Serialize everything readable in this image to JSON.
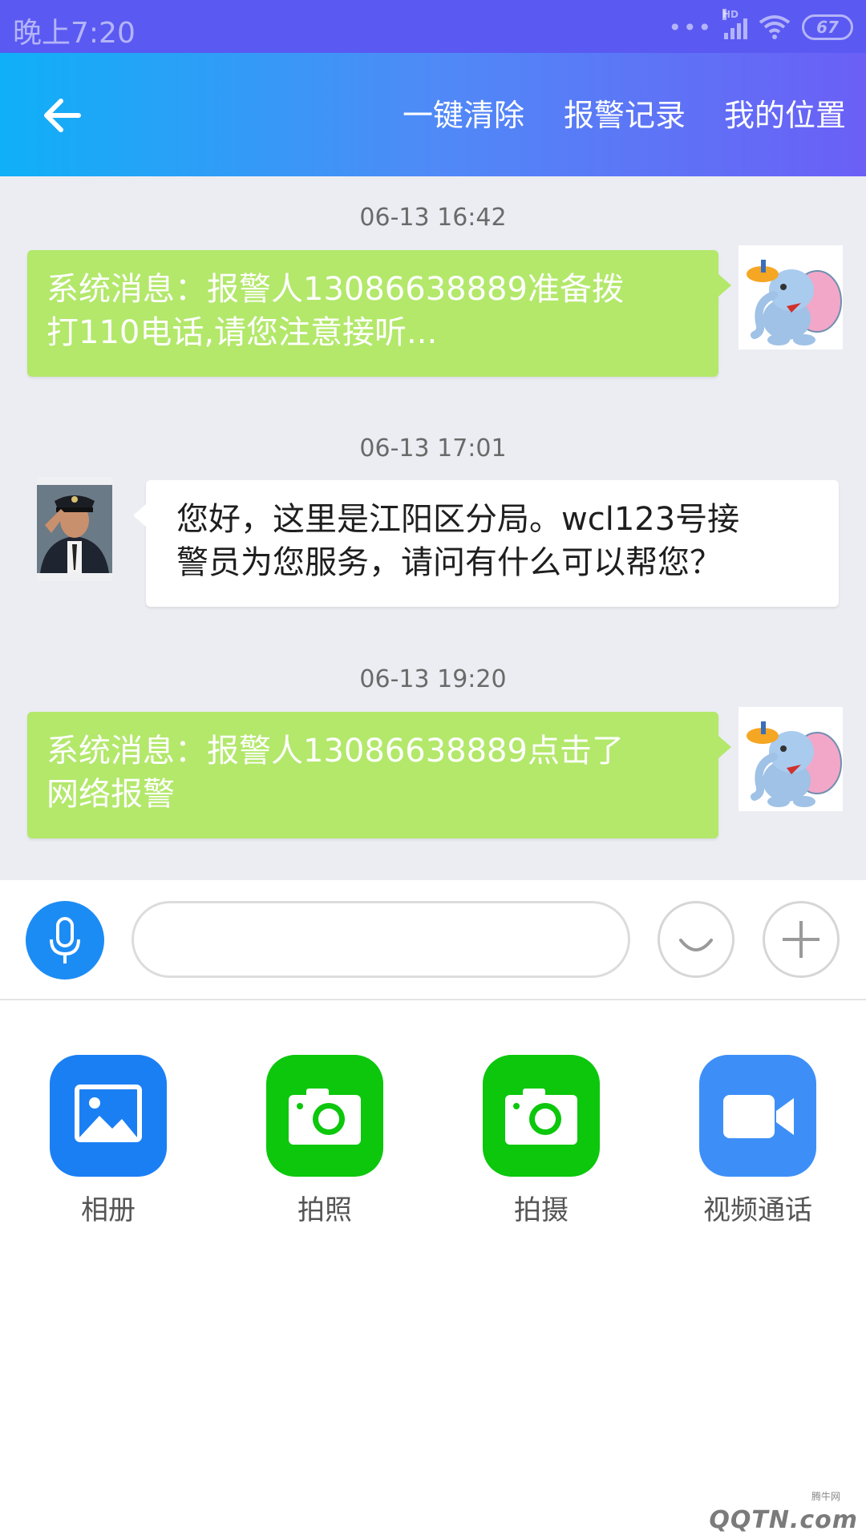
{
  "status_bar": {
    "time": "晚上7:20",
    "network_label": "HD",
    "battery_level": "67"
  },
  "app_bar": {
    "back_icon": "arrow-left-icon",
    "actions": [
      "一键清除",
      "报警记录",
      "我的位置"
    ]
  },
  "messages": [
    {
      "time": "06-13 16:42",
      "sender": "system",
      "avatar": "cartoon-elephant-avatar",
      "lines": [
        "系统消息：报警人13086638889准备拨",
        "打110电话,请您注意接听..."
      ]
    },
    {
      "time": "06-13 17:01",
      "sender": "officer",
      "avatar": "police-officer-avatar",
      "lines": [
        "您好，这里是江阳区分局。wcl123号接",
        "警员为您服务，请问有什么可以帮您？"
      ]
    },
    {
      "time": "06-13 19:20",
      "sender": "system",
      "avatar": "cartoon-elephant-avatar",
      "lines": [
        "系统消息：报警人13086638889点击了",
        "网络报警"
      ]
    }
  ],
  "input_bar": {
    "mic_icon": "microphone-icon",
    "input_value": "",
    "emoji_icon": "smiley-icon",
    "plus_icon": "plus-icon"
  },
  "tools": [
    {
      "label": "相册",
      "icon": "image-icon",
      "color": "#1b7ff4"
    },
    {
      "label": "拍照",
      "icon": "camera-icon",
      "color": "#0cc70c"
    },
    {
      "label": "拍摄",
      "icon": "camera-icon",
      "color": "#0cc70c"
    },
    {
      "label": "视频通话",
      "icon": "video-camera-icon",
      "color": "#3d8ff7"
    }
  ],
  "watermark": {
    "small": "腾牛网",
    "text": "QQTN.com"
  }
}
